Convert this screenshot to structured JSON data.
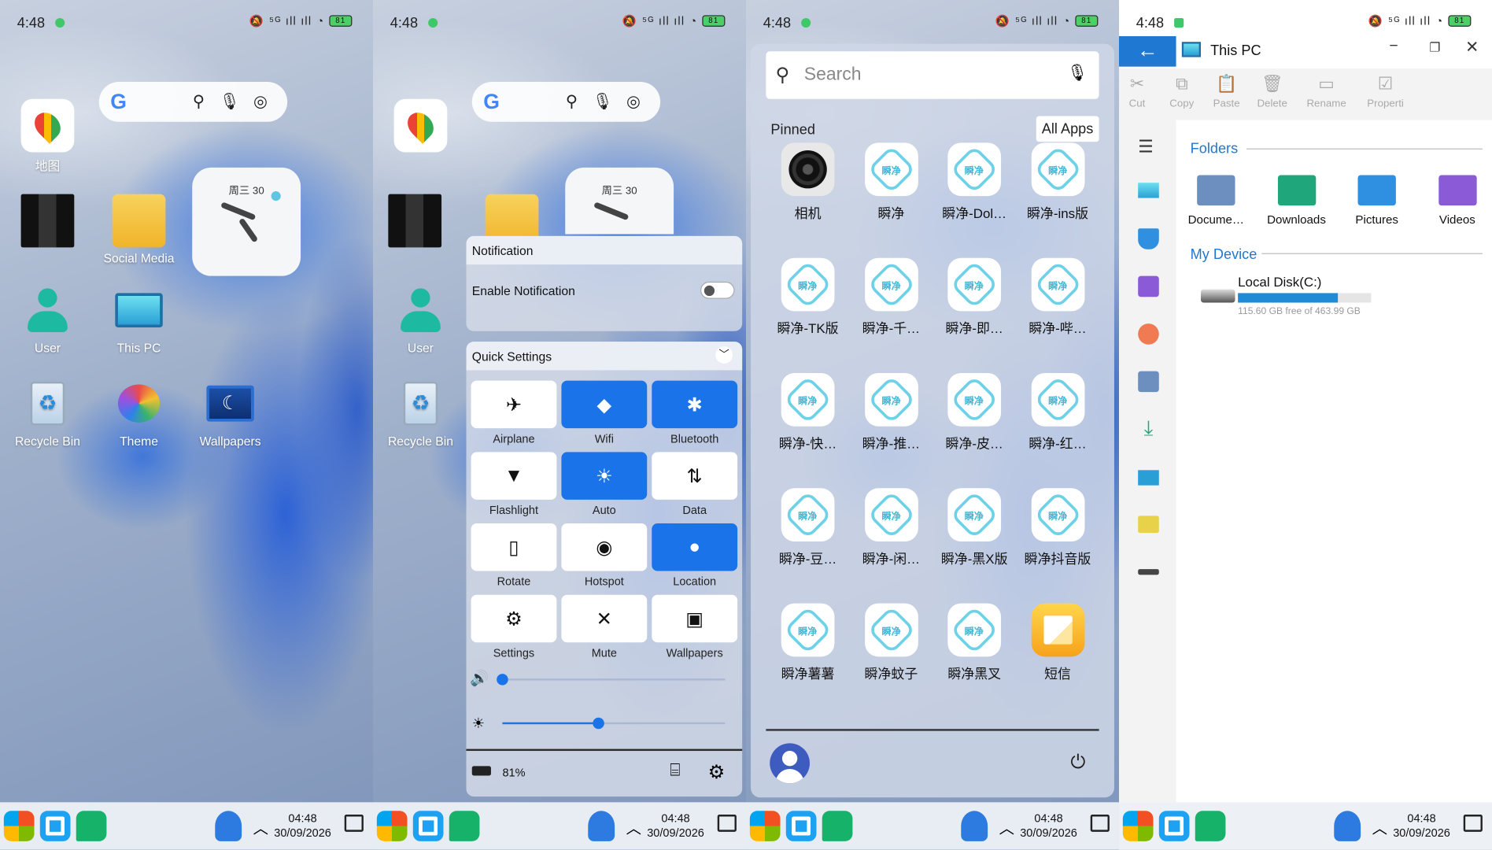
{
  "status": {
    "time": "4:48",
    "signal": "⁵ᴳ ıll ıll",
    "battery": "81"
  },
  "home": {
    "icons": [
      {
        "label": "地图",
        "name": "maps"
      },
      {
        "label": "",
        "name": "pixelated-app"
      },
      {
        "label": "Social Media",
        "name": "social-media-folder"
      },
      {
        "label": "User",
        "name": "user"
      },
      {
        "label": "This PC",
        "name": "this-pc"
      },
      {
        "label": "Recycle Bin",
        "name": "recycle-bin"
      },
      {
        "label": "Theme",
        "name": "theme"
      },
      {
        "label": "Wallpapers",
        "name": "wallpapers"
      }
    ],
    "clock_date": "周三 30",
    "google_letter": "G"
  },
  "taskbar": {
    "time": "04:48",
    "date": "30/09/2026"
  },
  "notification": {
    "header": "Notification",
    "enable_label": "Enable Notification",
    "enabled": false
  },
  "quick_settings": {
    "header": "Quick Settings",
    "tiles": [
      {
        "label": "Airplane",
        "icon": "airplane-icon",
        "glyph": "✈",
        "on": false
      },
      {
        "label": "Wifi",
        "icon": "wifi-icon",
        "glyph": "◆",
        "on": true
      },
      {
        "label": "Bluetooth",
        "icon": "bluetooth-icon",
        "glyph": "✱",
        "on": true
      },
      {
        "label": "Flashlight",
        "icon": "flashlight-icon",
        "glyph": "▼",
        "on": false
      },
      {
        "label": "Auto",
        "icon": "brightness-auto-icon",
        "glyph": "☀",
        "on": true
      },
      {
        "label": "Data",
        "icon": "mobile-data-icon",
        "glyph": "⇅",
        "on": false
      },
      {
        "label": "Rotate",
        "icon": "rotate-icon",
        "glyph": "▯",
        "on": false
      },
      {
        "label": "Hotspot",
        "icon": "hotspot-icon",
        "glyph": "◉",
        "on": false
      },
      {
        "label": "Location",
        "icon": "location-icon",
        "glyph": "●",
        "on": true
      },
      {
        "label": "Settings",
        "icon": "gear-icon",
        "glyph": "⚙",
        "on": false
      },
      {
        "label": "Mute",
        "icon": "mute-icon",
        "glyph": "✕",
        "on": false
      },
      {
        "label": "Wallpapers",
        "icon": "wallpaper-icon",
        "glyph": "▣",
        "on": false
      }
    ],
    "volume_level": 0.0,
    "brightness_level": 0.43,
    "battery_text": "81%"
  },
  "start_menu": {
    "search_placeholder": "Search",
    "pinned_label": "Pinned",
    "all_apps_label": "All Apps",
    "apps": [
      {
        "label": "相机",
        "kind": "camera"
      },
      {
        "label": "瞬净",
        "kind": "hex"
      },
      {
        "label": "瞬净-Dol…",
        "kind": "hex"
      },
      {
        "label": "瞬净-ins版",
        "kind": "hex"
      },
      {
        "label": "瞬净-TK版",
        "kind": "hex"
      },
      {
        "label": "瞬净-千…",
        "kind": "hex"
      },
      {
        "label": "瞬净-即…",
        "kind": "hex"
      },
      {
        "label": "瞬净-哔…",
        "kind": "hex"
      },
      {
        "label": "瞬净-快…",
        "kind": "hex"
      },
      {
        "label": "瞬净-推…",
        "kind": "hex"
      },
      {
        "label": "瞬净-皮…",
        "kind": "hex"
      },
      {
        "label": "瞬净-红…",
        "kind": "hex"
      },
      {
        "label": "瞬净-豆…",
        "kind": "hex"
      },
      {
        "label": "瞬净-闲…",
        "kind": "hex"
      },
      {
        "label": "瞬净-黑X版",
        "kind": "hex"
      },
      {
        "label": "瞬净抖音版",
        "kind": "hex"
      },
      {
        "label": "瞬净薯薯",
        "kind": "hex"
      },
      {
        "label": "瞬净蚊子",
        "kind": "hex"
      },
      {
        "label": "瞬净黑叉",
        "kind": "hex"
      },
      {
        "label": "短信",
        "kind": "sms"
      }
    ],
    "hex_text": "瞬净"
  },
  "explorer": {
    "title": "This PC",
    "toolbar": [
      "Cut",
      "Copy",
      "Paste",
      "Delete",
      "Rename",
      "Properti"
    ],
    "toolbar_display": [
      "Cut",
      "Copy",
      "Paste",
      "Delete",
      "Rename",
      "Properti"
    ],
    "folders_label": "Folders",
    "folders": [
      {
        "label": "Docume…",
        "color": "#6d8fbf"
      },
      {
        "label": "Downloads",
        "color": "#1fa67a"
      },
      {
        "label": "Pictures",
        "color": "#2f8fe0"
      },
      {
        "label": "Videos",
        "color": "#8b5ad6"
      }
    ],
    "device_label": "My Device",
    "disk_name": "Local Disk(C:)",
    "disk_free": "115.60 GB free of 463.99 GB",
    "disk_used_fraction": 0.75
  },
  "colors": {
    "accent": "#1a73e8",
    "explorer_blue": "#1f78d1",
    "hex_cyan": "#6dd1e8"
  }
}
